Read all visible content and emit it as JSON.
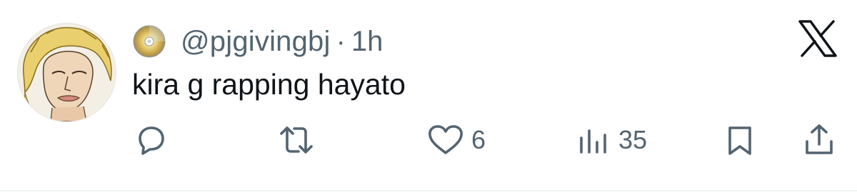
{
  "user": {
    "handle": "@pjgivingbj",
    "separator": "·",
    "time": "1h",
    "badge_icon": "cd-disc-icon",
    "avatar": "anime-blond-portrait"
  },
  "tweet": {
    "text": "kira g rapping hayato"
  },
  "brand": {
    "logo": "x-logo-icon"
  },
  "actions": {
    "reply": {
      "icon": "reply-bubble-icon",
      "count": ""
    },
    "retweet": {
      "icon": "retweet-icon",
      "count": ""
    },
    "like": {
      "icon": "heart-icon",
      "count": "6"
    },
    "views": {
      "icon": "views-bar-chart-icon",
      "count": "35"
    },
    "bookmark": {
      "icon": "bookmark-icon"
    },
    "share": {
      "icon": "share-upload-icon"
    }
  },
  "colors": {
    "text_primary": "#0f1419",
    "text_secondary": "#536471",
    "divider": "#eff3f4"
  }
}
